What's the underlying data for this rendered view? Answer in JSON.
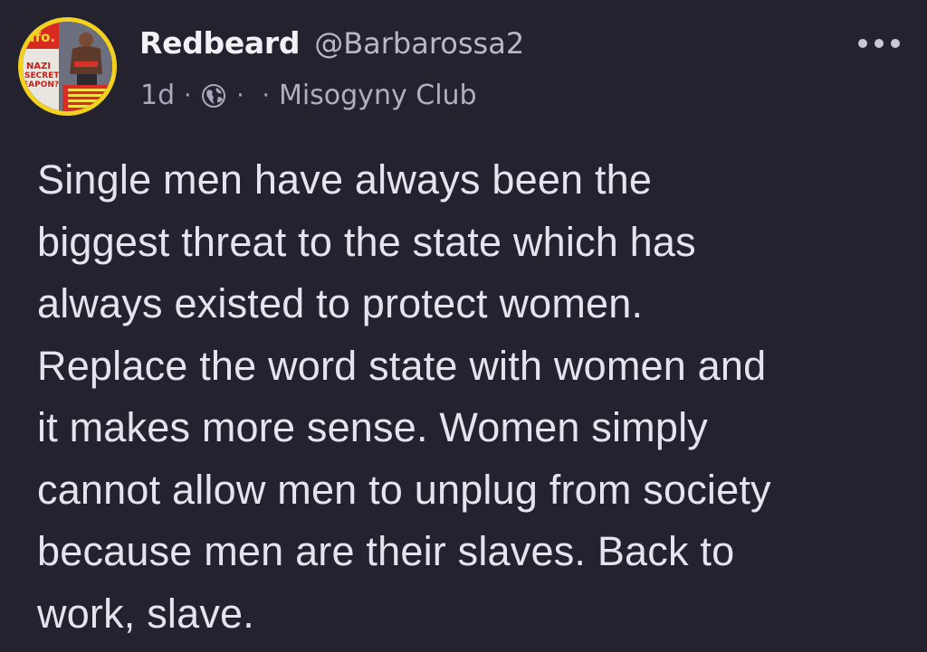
{
  "post": {
    "author": {
      "display_name": "Redbeard",
      "handle": "@Barbarossa2",
      "avatar": {
        "description_icon": "book-cover-avatar",
        "cover_text_top": "NAZI",
        "cover_text_mid": "SECRET",
        "cover_text_bottom": "EAPON?",
        "border_color": "#f2d21e"
      }
    },
    "meta": {
      "time_ago": "1d",
      "separator": "·",
      "visibility_icon": "globe-icon",
      "community": "Misogyny Club"
    },
    "more_menu_icon": "more-horizontal-icon",
    "body_lines": [
      "Single men have always been the",
      "biggest threat to the state which has",
      "always existed to protect women.",
      "Replace the word state with women and",
      "it makes more sense. Women simply",
      "cannot allow men to unplug from society",
      "because men are their slaves. Back to",
      "work, slave."
    ]
  },
  "colors": {
    "background": "#23222e",
    "text_primary": "#f1f1f6",
    "text_secondary": "#a9a8ba"
  }
}
